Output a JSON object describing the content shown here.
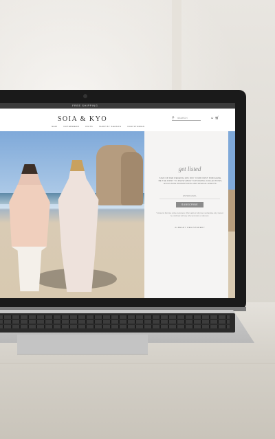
{
  "site": {
    "topbar_text": "FREE SHIPPING",
    "brand": "SOIA & KYO",
    "nav_items": [
      "NEW",
      "OUTERWEAR",
      "KNITS",
      "SHOP BY SEASON",
      "OUR STORIES"
    ],
    "search_placeholder": "SEARCH"
  },
  "panel": {
    "title": "get listed",
    "copy": "SIGN UP AND RECEIVE 10% OFF YOUR FIRST PURCHASE. BE THE FIRST TO KNOW ABOUT UPCOMING COLLECTIONS, EXCLUSIVE PROMOTIONS AND SPECIAL EVENTS.",
    "input_placeholder": "ENTER EMAIL",
    "button_label": "SUBSCRIBE",
    "fine_print": "*Limited to first time online customers. Offer valid on full price merchandise only. Cannot be combined with any other promotion or discount.",
    "link_text": "ALREADY REGISTERED?"
  },
  "colors": {
    "accent": "#8b8b8b",
    "topbar": "#3b3b3b"
  }
}
